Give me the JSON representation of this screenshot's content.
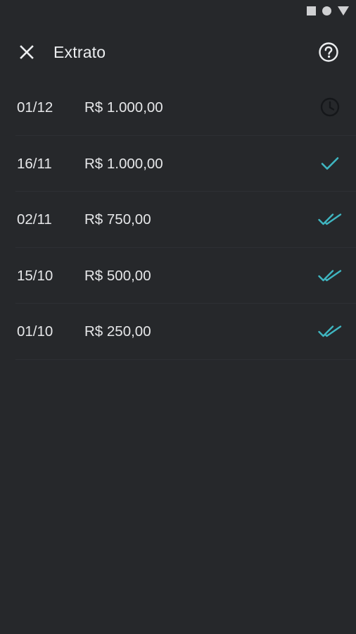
{
  "status_bar": {
    "icons": [
      "stop-square-icon",
      "record-circle-icon",
      "signal-triangle-icon"
    ]
  },
  "header": {
    "title": "Extrato",
    "close_icon": "close-icon",
    "help_icon": "help-circle-icon"
  },
  "colors": {
    "background": "#26282b",
    "text": "#e6e7e9",
    "accent": "#3fb6c1",
    "pending": "#1a1c1f"
  },
  "entries": [
    {
      "date": "01/12",
      "amount": "R$ 1.000,00",
      "status_icon": "clock-icon"
    },
    {
      "date": "16/11",
      "amount": "R$ 1.000,00",
      "status_icon": "check-icon"
    },
    {
      "date": "02/11",
      "amount": "R$ 750,00",
      "status_icon": "double-check-icon"
    },
    {
      "date": "15/10",
      "amount": "R$ 500,00",
      "status_icon": "double-check-icon"
    },
    {
      "date": "01/10",
      "amount": "R$ 250,00",
      "status_icon": "double-check-icon"
    }
  ]
}
